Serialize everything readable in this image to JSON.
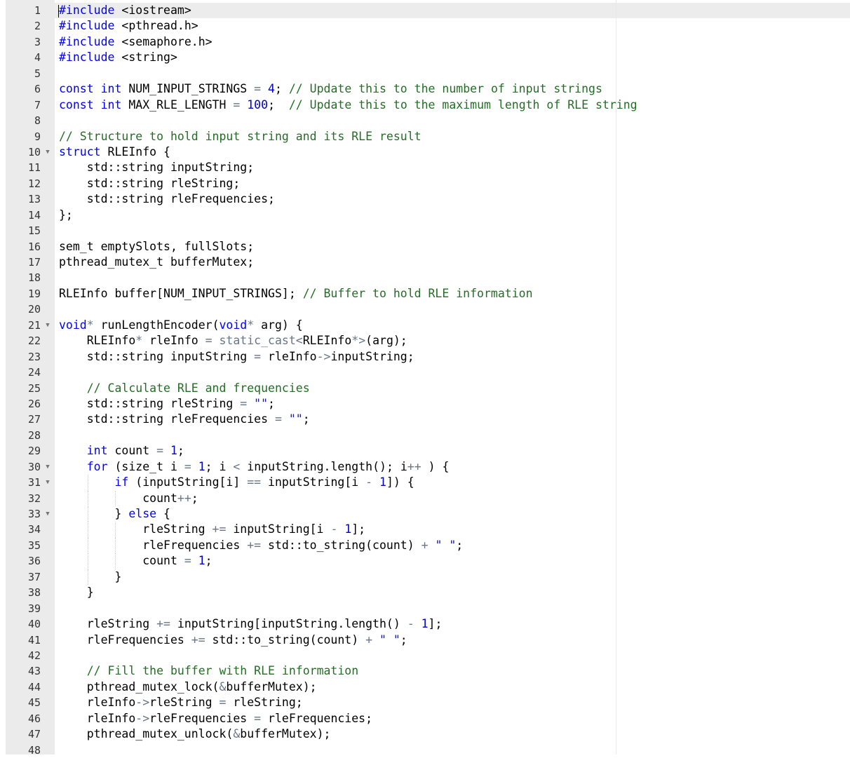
{
  "editor": {
    "language": "cpp",
    "cursor_line": 1,
    "fold_icon": "triangle-down",
    "colors": {
      "keyword": "#0000ff",
      "comment": "#236e24",
      "number": "#0000cd",
      "string": "#1a1aa6",
      "operator": "#687687",
      "gutter": "#ebebeb"
    },
    "lines": [
      {
        "n": "1",
        "fold": false,
        "tokens": [
          [
            "inc",
            "#include"
          ],
          [
            "",
            "&nbsp;&lt;iostream&gt;"
          ]
        ]
      },
      {
        "n": "2",
        "fold": false,
        "tokens": [
          [
            "inc",
            "#include"
          ],
          [
            "",
            "&nbsp;&lt;pthread.h&gt;"
          ]
        ]
      },
      {
        "n": "3",
        "fold": false,
        "tokens": [
          [
            "inc",
            "#include"
          ],
          [
            "",
            "&nbsp;&lt;semaphore.h&gt;"
          ]
        ]
      },
      {
        "n": "4",
        "fold": false,
        "tokens": [
          [
            "inc",
            "#include"
          ],
          [
            "",
            "&nbsp;&lt;string&gt;"
          ]
        ]
      },
      {
        "n": "5",
        "fold": false,
        "tokens": []
      },
      {
        "n": "6",
        "fold": false,
        "tokens": [
          [
            "k",
            "const"
          ],
          [
            "",
            " "
          ],
          [
            "t",
            "int"
          ],
          [
            "",
            " NUM_INPUT_STRINGS "
          ],
          [
            "op",
            "="
          ],
          [
            "",
            " "
          ],
          [
            "n",
            "4"
          ],
          [
            "",
            "; "
          ],
          [
            "c",
            "// Update this to the number of input strings"
          ]
        ]
      },
      {
        "n": "7",
        "fold": false,
        "tokens": [
          [
            "k",
            "const"
          ],
          [
            "",
            " "
          ],
          [
            "t",
            "int"
          ],
          [
            "",
            " MAX_RLE_LENGTH "
          ],
          [
            "op",
            "="
          ],
          [
            "",
            " "
          ],
          [
            "n",
            "100"
          ],
          [
            "",
            ";  "
          ],
          [
            "c",
            "// Update this to the maximum length of RLE string"
          ]
        ]
      },
      {
        "n": "8",
        "fold": false,
        "tokens": []
      },
      {
        "n": "9",
        "fold": false,
        "tokens": [
          [
            "c",
            "// Structure to hold input string and its RLE result"
          ]
        ]
      },
      {
        "n": "10",
        "fold": true,
        "tokens": [
          [
            "k",
            "struct"
          ],
          [
            "",
            " RLEInfo {"
          ]
        ]
      },
      {
        "n": "11",
        "fold": false,
        "tokens": [
          [
            "",
            "    std::string inputString;"
          ]
        ]
      },
      {
        "n": "12",
        "fold": false,
        "tokens": [
          [
            "",
            "    std::string rleString;"
          ]
        ]
      },
      {
        "n": "13",
        "fold": false,
        "tokens": [
          [
            "",
            "    std::string rleFrequencies;"
          ]
        ]
      },
      {
        "n": "14",
        "fold": false,
        "tokens": [
          [
            "",
            "};"
          ]
        ]
      },
      {
        "n": "15",
        "fold": false,
        "tokens": []
      },
      {
        "n": "16",
        "fold": false,
        "tokens": [
          [
            "",
            "sem_t emptySlots, fullSlots;"
          ]
        ]
      },
      {
        "n": "17",
        "fold": false,
        "tokens": [
          [
            "",
            "pthread_mutex_t bufferMutex;"
          ]
        ]
      },
      {
        "n": "18",
        "fold": false,
        "tokens": []
      },
      {
        "n": "19",
        "fold": false,
        "tokens": [
          [
            "",
            "RLEInfo buffer[NUM_INPUT_STRINGS]; "
          ],
          [
            "c",
            "// Buffer to hold RLE information"
          ]
        ]
      },
      {
        "n": "20",
        "fold": false,
        "tokens": []
      },
      {
        "n": "21",
        "fold": true,
        "tokens": [
          [
            "t",
            "void"
          ],
          [
            "op",
            "*"
          ],
          [
            "",
            " runLengthEncoder("
          ],
          [
            "t",
            "void"
          ],
          [
            "op",
            "*"
          ],
          [
            "",
            " arg) {"
          ]
        ]
      },
      {
        "n": "22",
        "fold": false,
        "tokens": [
          [
            "",
            "    RLEInfo"
          ],
          [
            "op",
            "*"
          ],
          [
            "",
            " rleInfo "
          ],
          [
            "op",
            "="
          ],
          [
            "",
            " "
          ],
          [
            "op",
            "static_cast&lt;"
          ],
          [
            "",
            "RLEInfo"
          ],
          [
            "op",
            "*&gt;"
          ],
          [
            "",
            "(arg);"
          ]
        ]
      },
      {
        "n": "23",
        "fold": false,
        "tokens": [
          [
            "",
            "    std::string inputString "
          ],
          [
            "op",
            "="
          ],
          [
            "",
            " rleInfo"
          ],
          [
            "op",
            "-&gt;"
          ],
          [
            "",
            "inputString;"
          ]
        ]
      },
      {
        "n": "24",
        "fold": false,
        "tokens": []
      },
      {
        "n": "25",
        "fold": false,
        "tokens": [
          [
            "",
            "    "
          ],
          [
            "c",
            "// Calculate RLE and frequencies"
          ]
        ]
      },
      {
        "n": "26",
        "fold": false,
        "tokens": [
          [
            "",
            "    std::string rleString "
          ],
          [
            "op",
            "="
          ],
          [
            "",
            " "
          ],
          [
            "s",
            "\"\""
          ],
          [
            "",
            ";"
          ]
        ]
      },
      {
        "n": "27",
        "fold": false,
        "tokens": [
          [
            "",
            "    std::string rleFrequencies "
          ],
          [
            "op",
            "="
          ],
          [
            "",
            " "
          ],
          [
            "s",
            "\"\""
          ],
          [
            "",
            ";"
          ]
        ]
      },
      {
        "n": "28",
        "fold": false,
        "tokens": []
      },
      {
        "n": "29",
        "fold": false,
        "tokens": [
          [
            "",
            "    "
          ],
          [
            "t",
            "int"
          ],
          [
            "",
            " count "
          ],
          [
            "op",
            "="
          ],
          [
            "",
            " "
          ],
          [
            "n",
            "1"
          ],
          [
            "",
            ";"
          ]
        ]
      },
      {
        "n": "30",
        "fold": true,
        "tokens": [
          [
            "",
            "    "
          ],
          [
            "k",
            "for"
          ],
          [
            "",
            " (size_t i "
          ],
          [
            "op",
            "="
          ],
          [
            "",
            " "
          ],
          [
            "n",
            "1"
          ],
          [
            "",
            "; i "
          ],
          [
            "op",
            "&lt;"
          ],
          [
            "",
            " inputString.length(); i"
          ],
          [
            "op",
            "++"
          ],
          [
            "",
            " ) {"
          ]
        ]
      },
      {
        "n": "31",
        "fold": true,
        "tokens": [
          [
            "",
            "        "
          ],
          [
            "k",
            "if"
          ],
          [
            "",
            " (inputString[i] "
          ],
          [
            "op",
            "=="
          ],
          [
            "",
            " inputString[i "
          ],
          [
            "op",
            "-"
          ],
          [
            "",
            " "
          ],
          [
            "n",
            "1"
          ],
          [
            "",
            "]) {"
          ]
        ]
      },
      {
        "n": "32",
        "fold": false,
        "tokens": [
          [
            "",
            "            count"
          ],
          [
            "op",
            "++"
          ],
          [
            "",
            ";"
          ]
        ]
      },
      {
        "n": "33",
        "fold": true,
        "tokens": [
          [
            "",
            "        } "
          ],
          [
            "k",
            "else"
          ],
          [
            "",
            " {"
          ]
        ]
      },
      {
        "n": "34",
        "fold": false,
        "tokens": [
          [
            "",
            "            rleString "
          ],
          [
            "op",
            "+="
          ],
          [
            "",
            " inputString[i "
          ],
          [
            "op",
            "-"
          ],
          [
            "",
            " "
          ],
          [
            "n",
            "1"
          ],
          [
            "",
            "];"
          ]
        ]
      },
      {
        "n": "35",
        "fold": false,
        "tokens": [
          [
            "",
            "            rleFrequencies "
          ],
          [
            "op",
            "+="
          ],
          [
            "",
            " std::to_string(count) "
          ],
          [
            "op",
            "+"
          ],
          [
            "",
            " "
          ],
          [
            "s",
            "\" \""
          ],
          [
            "",
            ";"
          ]
        ]
      },
      {
        "n": "36",
        "fold": false,
        "tokens": [
          [
            "",
            "            count "
          ],
          [
            "op",
            "="
          ],
          [
            "",
            " "
          ],
          [
            "n",
            "1"
          ],
          [
            "",
            ";"
          ]
        ]
      },
      {
        "n": "37",
        "fold": false,
        "tokens": [
          [
            "",
            "        }"
          ]
        ]
      },
      {
        "n": "38",
        "fold": false,
        "tokens": [
          [
            "",
            "    }"
          ]
        ]
      },
      {
        "n": "39",
        "fold": false,
        "tokens": []
      },
      {
        "n": "40",
        "fold": false,
        "tokens": [
          [
            "",
            "    rleString "
          ],
          [
            "op",
            "+="
          ],
          [
            "",
            " inputString[inputString.length() "
          ],
          [
            "op",
            "-"
          ],
          [
            "",
            " "
          ],
          [
            "n",
            "1"
          ],
          [
            "",
            "];"
          ]
        ]
      },
      {
        "n": "41",
        "fold": false,
        "tokens": [
          [
            "",
            "    rleFrequencies "
          ],
          [
            "op",
            "+="
          ],
          [
            "",
            " std::to_string(count) "
          ],
          [
            "op",
            "+"
          ],
          [
            "",
            " "
          ],
          [
            "s",
            "\" \""
          ],
          [
            "",
            ";"
          ]
        ]
      },
      {
        "n": "42",
        "fold": false,
        "tokens": []
      },
      {
        "n": "43",
        "fold": false,
        "tokens": [
          [
            "",
            "    "
          ],
          [
            "c",
            "// Fill the buffer with RLE information"
          ]
        ]
      },
      {
        "n": "44",
        "fold": false,
        "tokens": [
          [
            "",
            "    pthread_mutex_lock("
          ],
          [
            "op",
            "&amp;"
          ],
          [
            "",
            "bufferMutex);"
          ]
        ]
      },
      {
        "n": "45",
        "fold": false,
        "tokens": [
          [
            "",
            "    rleInfo"
          ],
          [
            "op",
            "-&gt;"
          ],
          [
            "",
            "rleString "
          ],
          [
            "op",
            "="
          ],
          [
            "",
            " rleString;"
          ]
        ]
      },
      {
        "n": "46",
        "fold": false,
        "tokens": [
          [
            "",
            "    rleInfo"
          ],
          [
            "op",
            "-&gt;"
          ],
          [
            "",
            "rleFrequencies "
          ],
          [
            "op",
            "="
          ],
          [
            "",
            " rleFrequencies;"
          ]
        ]
      },
      {
        "n": "47",
        "fold": false,
        "tokens": [
          [
            "",
            "    pthread_mutex_unlock("
          ],
          [
            "op",
            "&amp;"
          ],
          [
            "",
            "bufferMutex);"
          ]
        ]
      },
      {
        "n": "48",
        "fold": false,
        "tokens": []
      }
    ]
  }
}
